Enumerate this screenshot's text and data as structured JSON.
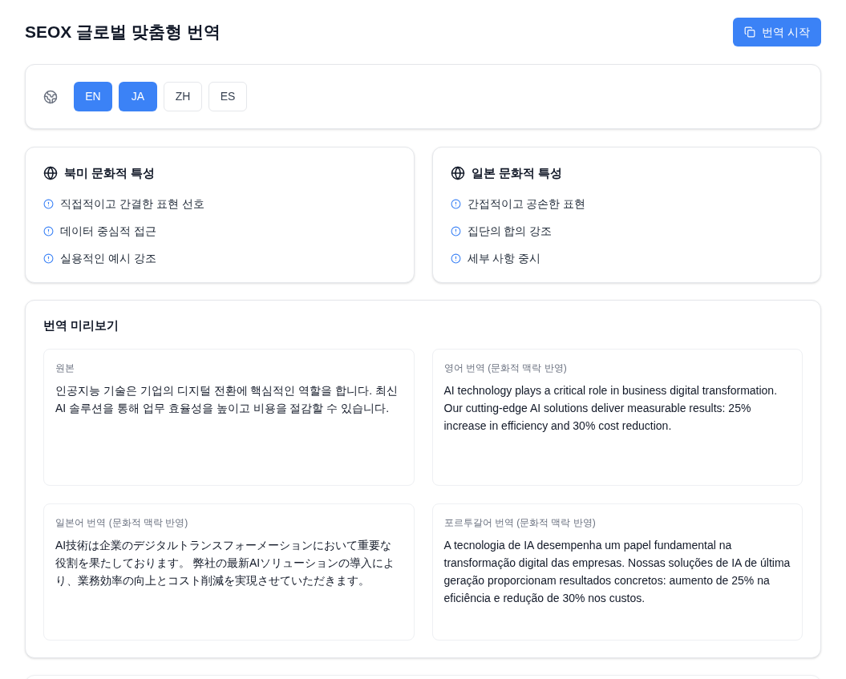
{
  "header": {
    "title": "SEOX 글로벌 맞춤형 번역",
    "start_button": "번역 시작"
  },
  "languages": [
    {
      "label": "EN",
      "selected": true
    },
    {
      "label": "JA",
      "selected": true
    },
    {
      "label": "ZH",
      "selected": false
    },
    {
      "label": "ES",
      "selected": false
    }
  ],
  "culture_cards": [
    {
      "title": "북미 문화적 특성",
      "items": [
        "직접적이고 간결한 표현 선호",
        "데이터 중심적 접근",
        "실용적인 예시 강조"
      ]
    },
    {
      "title": "일본 문화적 특성",
      "items": [
        "간접적이고 공손한 표현",
        "집단의 합의 강조",
        "세부 사항 중시"
      ]
    }
  ],
  "preview": {
    "title": "번역 미리보기",
    "panels": [
      {
        "label": "원본",
        "text": "인공지능 기술은 기업의 디지털 전환에 핵심적인 역할을 합니다. 최신 AI 솔루션을 통해 업무 효율성을 높이고 비용을 절감할 수 있습니다."
      },
      {
        "label": "영어 번역 (문화적 맥락 반영)",
        "text": "AI technology plays a critical role in business digital transformation. Our cutting-edge AI solutions deliver measurable results: 25% increase in efficiency and 30% cost reduction."
      },
      {
        "label": "일본어 번역 (문화적 맥락 반영)",
        "text": "AI技術は企業のデジタルトランスフォーメーションにおいて重要な役割を果たしております。 弊社の最新AIソリューションの導入により、業務効率の向上とコスト削減を実現させていただきます。"
      },
      {
        "label": "포르투갈어 번역 (문화적 맥락 반영)",
        "text": "A tecnologia de IA desempenha um papel fundamental na transformação digital das empresas. Nossas soluções de IA de última geração proporcionam resultados concretos: aumento de 25% na eficiência e redução de 30% nos custos."
      }
    ]
  }
}
